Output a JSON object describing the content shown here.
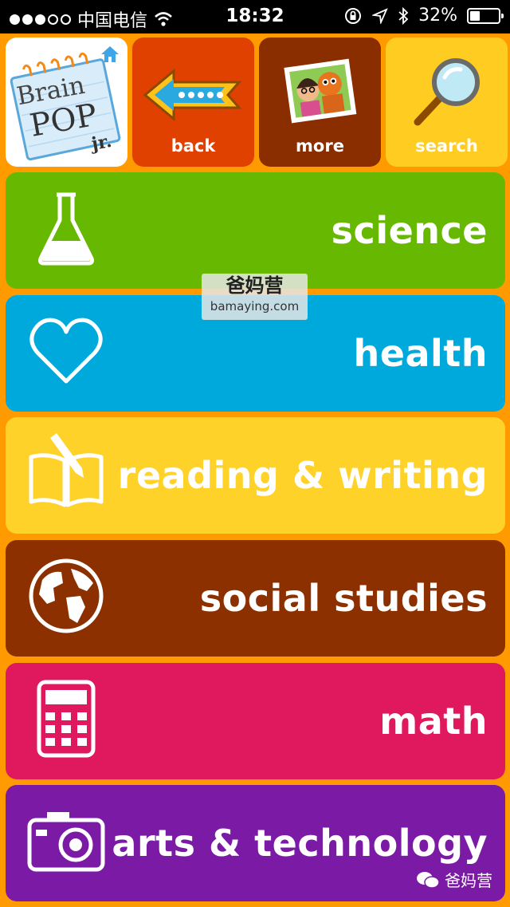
{
  "status_bar": {
    "carrier": "中国电信",
    "time": "18:32",
    "battery": "32%",
    "battery_level": 0.32
  },
  "top_nav": {
    "logo_text": [
      "Brain",
      "POP",
      "jr."
    ],
    "back_label": "back",
    "more_label": "more",
    "search_label": "search"
  },
  "categories": [
    {
      "label": "science",
      "icon": "flask-icon",
      "color": "#67B800"
    },
    {
      "label": "health",
      "icon": "heart-icon",
      "color": "#00A9DB"
    },
    {
      "label": "reading & writing",
      "icon": "book-pencil-icon",
      "color": "#FFD22A"
    },
    {
      "label": "social studies",
      "icon": "globe-icon",
      "color": "#8C3000"
    },
    {
      "label": "math",
      "icon": "calculator-icon",
      "color": "#E0195E"
    },
    {
      "label": "arts & technology",
      "icon": "camera-icon",
      "color": "#7A1AA5"
    }
  ],
  "watermark": {
    "title": "爸妈营",
    "url": "bamaying.com",
    "wechat": "爸妈营"
  }
}
